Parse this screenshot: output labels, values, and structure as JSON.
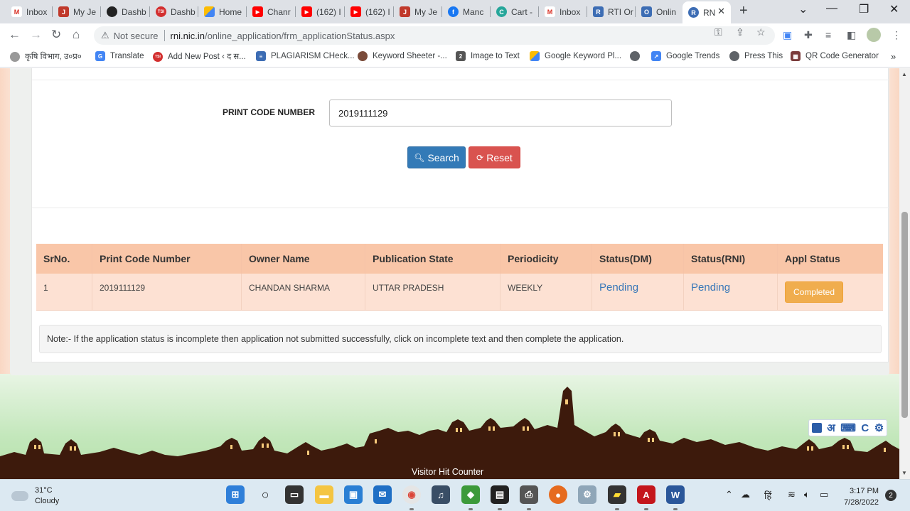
{
  "browser": {
    "tabs": [
      {
        "label": "Inbox",
        "icon": "gmail-icon",
        "color": "#d93025"
      },
      {
        "label": "My Je",
        "icon": "jeetho-icon",
        "color": "#c0392b"
      },
      {
        "label": "Dashb",
        "icon": "dashboard-icon",
        "color": "#222222"
      },
      {
        "label": "Dashb",
        "icon": "tsi-icon",
        "color": "#d32f2f"
      },
      {
        "label": "Home",
        "icon": "google-ads-icon",
        "color": "#fbbc04"
      },
      {
        "label": "Chanr",
        "icon": "youtube-icon",
        "color": "#ff0000"
      },
      {
        "label": "(162) I",
        "icon": "youtube-icon",
        "color": "#ff0000"
      },
      {
        "label": "(162) I",
        "icon": "youtube-icon",
        "color": "#ff0000"
      },
      {
        "label": "My Je",
        "icon": "jeetho-icon",
        "color": "#c0392b"
      },
      {
        "label": "Manc",
        "icon": "facebook-icon",
        "color": "#1877f2"
      },
      {
        "label": "Cart -",
        "icon": "cart-icon",
        "color": "#26a69a"
      },
      {
        "label": "Inbox",
        "icon": "gmail-icon",
        "color": "#d93025"
      },
      {
        "label": "RTI Or",
        "icon": "rti-icon",
        "color": "#3d6db4"
      },
      {
        "label": "Onlin",
        "icon": "online-icon",
        "color": "#3d6db4"
      },
      {
        "label": "RN",
        "icon": "rni-icon",
        "color": "#3d6db4",
        "active": true
      }
    ],
    "address": {
      "security": "Not secure",
      "host": "rni.nic.in",
      "path": "/online_application/frm_applicationStatus.aspx"
    },
    "bookmarks": [
      {
        "label": "कृषि विभाग, उ०प्र०",
        "icon": "agri-icon",
        "color": "#888888"
      },
      {
        "label": "Translate",
        "icon": "translate-icon",
        "color": "#4285f4"
      },
      {
        "label": "Add New Post ‹ द स...",
        "icon": "tsi-icon",
        "color": "#d32f2f"
      },
      {
        "label": "PLAGIARISM CHeck...",
        "icon": "plagiarism-icon",
        "color": "#3d6db4"
      },
      {
        "label": "Keyword Sheeter -...",
        "icon": "keyword-icon",
        "color": "#7a4b3a"
      },
      {
        "label": "Image to Text",
        "icon": "image-text-icon",
        "color": "#555555"
      },
      {
        "label": "Google Keyword Pl...",
        "icon": "google-ads-icon",
        "color": "#fbbc04"
      },
      {
        "label": "",
        "icon": "globe-icon",
        "color": "#5f6368"
      },
      {
        "label": "Google Trends",
        "icon": "trends-icon",
        "color": "#4285f4"
      },
      {
        "label": "Press This",
        "icon": "press-icon",
        "color": "#5f6368"
      },
      {
        "label": "QR Code Generator",
        "icon": "qr-icon",
        "color": "#7a3b3b"
      }
    ]
  },
  "form": {
    "print_code_label": "PRINT CODE NUMBER",
    "print_code_value": "2019111129",
    "search_label": "Search",
    "reset_label": "Reset"
  },
  "table": {
    "headers": [
      "SrNo.",
      "Print Code Number",
      "Owner Name",
      "Publication State",
      "Periodicity",
      "Status(DM)",
      "Status(RNI)",
      "Appl Status"
    ],
    "rows": [
      {
        "sr": "1",
        "print_code": "2019111129",
        "owner": "CHANDAN SHARMA",
        "state": "UTTAR PRADESH",
        "periodicity": "WEEKLY",
        "status_dm": "Pending",
        "status_rni": "Pending",
        "appl_status": "Completed"
      }
    ]
  },
  "note": "Note:- If the application status is incomplete then application not submitted successfully, click on incomplete text and then complete the application.",
  "footer": {
    "visitor_counter": "Visitor Hit Counter",
    "keyboard_widget": {
      "lang": "अ",
      "c": "C"
    }
  },
  "taskbar": {
    "weather_temp": "31°C",
    "weather_desc": "Cloudy",
    "lang_indicator": "हिं",
    "time": "3:17 PM",
    "date": "7/28/2022",
    "notifications": "2"
  },
  "colors": {
    "search_button": "#337ab7",
    "reset_button": "#d9534f",
    "table_header": "#f9c6a8",
    "table_row": "#fde1d3",
    "completed_badge": "#f0ad4e",
    "pending_link": "#3877b8",
    "skyline": "#3d1a0c"
  }
}
